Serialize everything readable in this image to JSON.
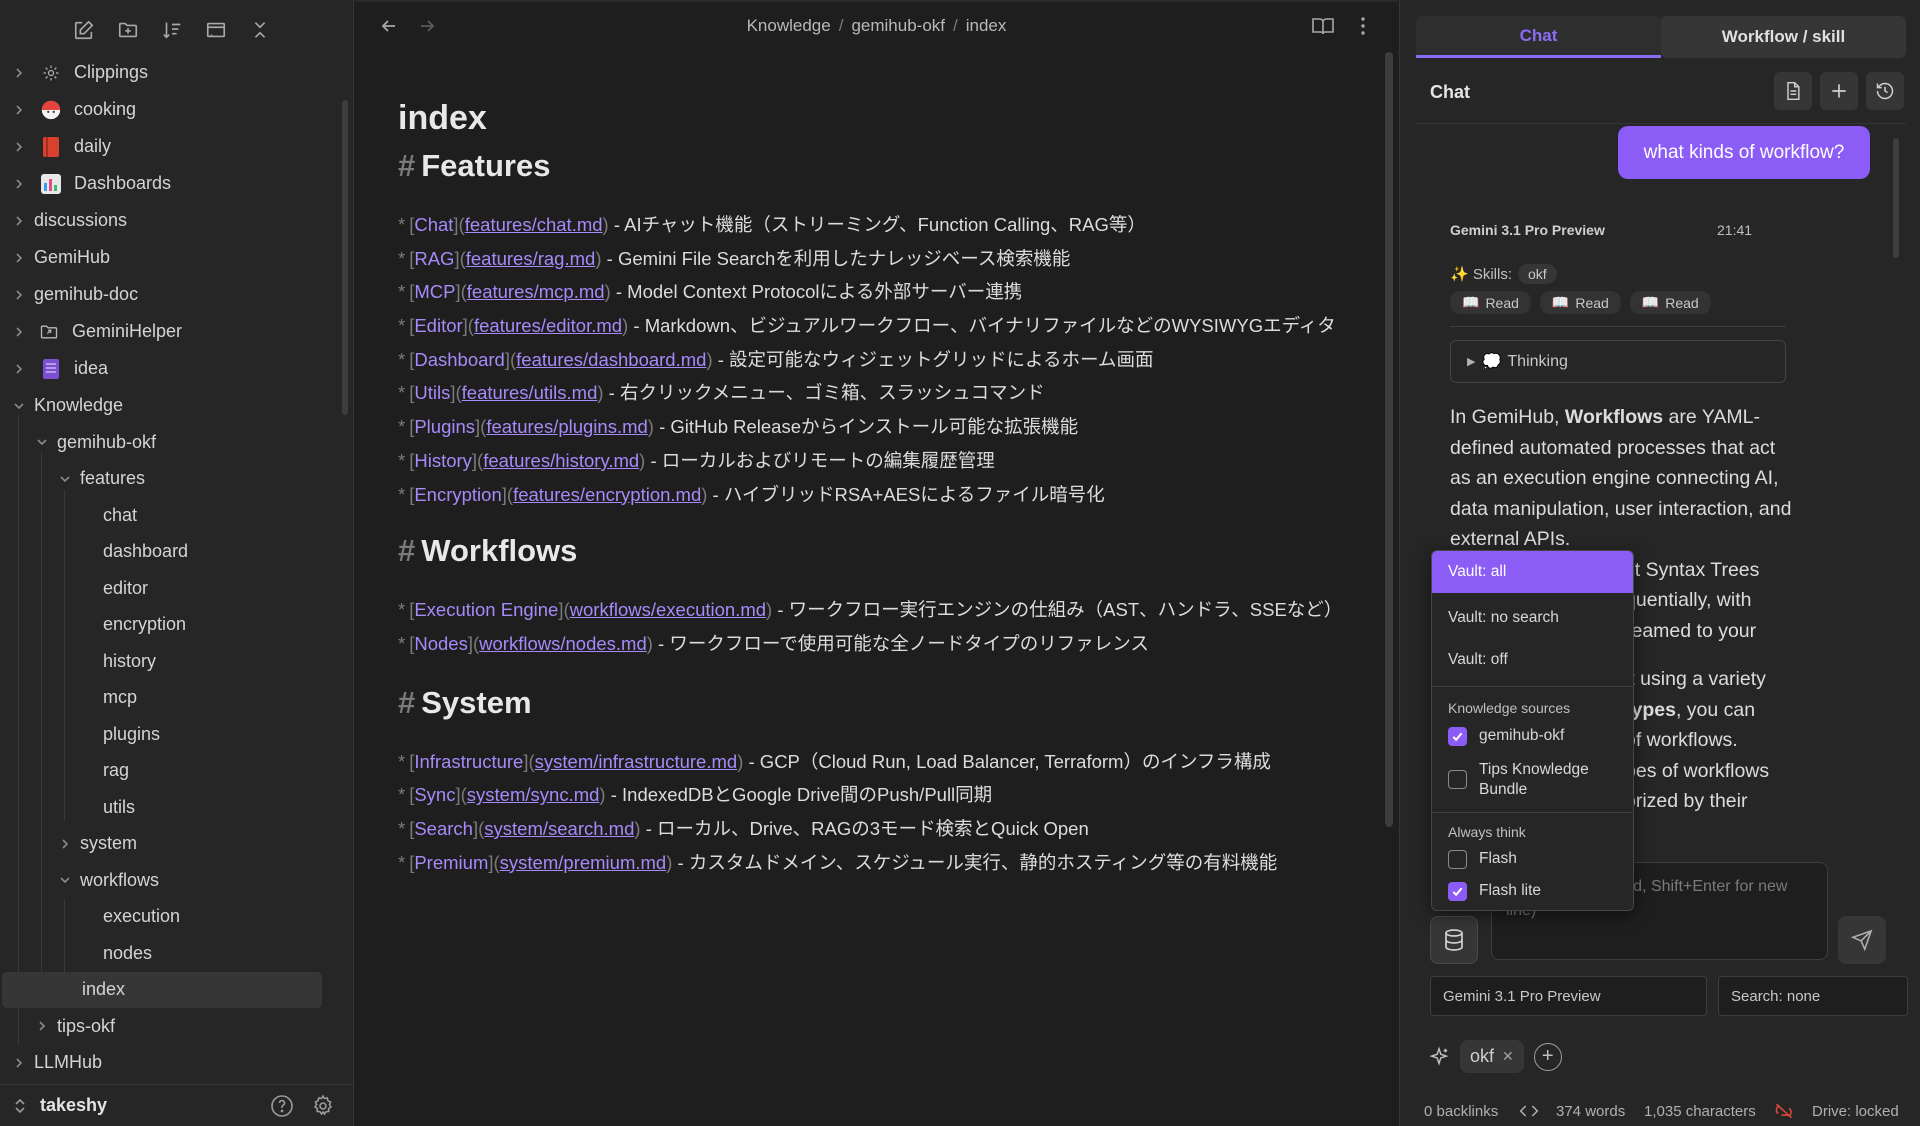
{
  "sidebar": {
    "toolbar": [
      "new-note-icon",
      "new-folder-icon",
      "sort-icon",
      "collapse-panel-icon",
      "collapse-all-icon"
    ],
    "items": [
      {
        "label": "Clippings",
        "icon": "clippings-icon"
      },
      {
        "label": "cooking",
        "icon": "cooking-icon"
      },
      {
        "label": "daily",
        "icon": "daily-icon"
      },
      {
        "label": "Dashboards",
        "icon": "dashboards-icon"
      },
      {
        "label": "discussions"
      },
      {
        "label": "GemiHub"
      },
      {
        "label": "gemihub-doc"
      },
      {
        "label": "GeminiHelper",
        "icon": "folder-link-icon"
      },
      {
        "label": "idea",
        "icon": "idea-icon"
      },
      {
        "label": "Knowledge"
      },
      {
        "label": "gemihub-okf"
      },
      {
        "label": "features"
      },
      {
        "label": "chat"
      },
      {
        "label": "dashboard"
      },
      {
        "label": "editor"
      },
      {
        "label": "encryption"
      },
      {
        "label": "history"
      },
      {
        "label": "mcp"
      },
      {
        "label": "plugins"
      },
      {
        "label": "rag"
      },
      {
        "label": "utils"
      },
      {
        "label": "system"
      },
      {
        "label": "workflows"
      },
      {
        "label": "execution"
      },
      {
        "label": "nodes"
      },
      {
        "label": "index"
      },
      {
        "label": "tips-okf"
      },
      {
        "label": "LLMHub"
      }
    ],
    "vault_name": "takeshy"
  },
  "editor": {
    "breadcrumb": [
      "Knowledge",
      "gemihub-okf",
      "index"
    ],
    "title": "index",
    "sections": [
      {
        "heading": "Features",
        "items": [
          {
            "text": "Chat",
            "url": "features/chat.md",
            "desc": " - AIチャット機能（ストリーミング、Function Calling、RAG等）"
          },
          {
            "text": "RAG",
            "url": "features/rag.md",
            "desc": " - Gemini File Searchを利用したナレッジベース検索機能"
          },
          {
            "text": "MCP",
            "url": "features/mcp.md",
            "desc": " - Model Context Protocolによる外部サーバー連携"
          },
          {
            "text": "Editor",
            "url": "features/editor.md",
            "desc": " - Markdown、ビジュアルワークフロー、バイナリファイルなどのWYSIWYGエディタ"
          },
          {
            "text": "Dashboard",
            "url": "features/dashboard.md",
            "desc": " - 設定可能なウィジェットグリッドによるホーム画面"
          },
          {
            "text": "Utils",
            "url": "features/utils.md",
            "desc": " - 右クリックメニュー、ゴミ箱、スラッシュコマンド"
          },
          {
            "text": "Plugins",
            "url": "features/plugins.md",
            "desc": " - GitHub Releaseからインストール可能な拡張機能"
          },
          {
            "text": "History",
            "url": "features/history.md",
            "desc": " - ローカルおよびリモートの編集履歴管理"
          },
          {
            "text": "Encryption",
            "url": "features/encryption.md",
            "desc": " - ハイブリッドRSA+AESによるファイル暗号化"
          }
        ]
      },
      {
        "heading": "Workflows",
        "items": [
          {
            "text": "Execution Engine",
            "url": "workflows/execution.md",
            "desc": " - ワークフロー実行エンジンの仕組み（AST、ハンドラ、SSEなど）"
          },
          {
            "text": "Nodes",
            "url": "workflows/nodes.md",
            "desc": " - ワークフローで使用可能な全ノードタイプのリファレンス"
          }
        ]
      },
      {
        "heading": "System",
        "items": [
          {
            "text": "Infrastructure",
            "url": "system/infrastructure.md",
            "desc": " - GCP（Cloud Run, Load Balancer, Terraform）のインフラ構成"
          },
          {
            "text": "Sync",
            "url": "system/sync.md",
            "desc": " - IndexedDBとGoogle Drive間のPush/Pull同期"
          },
          {
            "text": "Search",
            "url": "system/search.md",
            "desc": " - ローカル、Drive、RAGの3モード検索とQuick Open"
          },
          {
            "text": "Premium",
            "url": "system/premium.md",
            "desc": " - カスタムドメイン、スケジュール実行、静的ホスティング等の有料機能"
          }
        ]
      }
    ]
  },
  "right_panel": {
    "tabs": [
      "Chat",
      "Workflow / skill"
    ],
    "chat_title": "Chat",
    "user_message": "what kinds of workflow?",
    "model_name": "Gemini 3.1 Pro Preview",
    "message_time": "21:41",
    "skills_label": "✨ Skills:",
    "skill_tag": "okf",
    "read_chips": [
      "Read",
      "Read",
      "Read"
    ],
    "thinking_label": "Thinking",
    "answer": {
      "p1_pre": "In GemiHub, ",
      "p1_bold": "Workflows",
      "p1_post": " are YAML-defined automated processes that act as an execution engine connecting AI, data manipulation, user interaction, and external APIs.",
      "p1_tail": "ct Syntax Trees",
      "p1_tail2": "quentially, with",
      "p1_tail3": "reamed to your",
      "p2_a": "lt using a variety",
      "p2_bold": "types",
      "p2_b": ", you can",
      "p2_c": "of workflows.",
      "p2_d": "pes of workflows",
      "p2_e": "orized by their"
    },
    "input_placeholder": "ge... (Enter to send, Shift+Enter for new line)",
    "model_select": "Gemini 3.1 Pro Preview",
    "search_select": "Search: none",
    "active_skill": "okf",
    "status": {
      "backlinks": "0 backlinks",
      "words": "374 words",
      "chars": "1,035 characters",
      "drive": "Drive: locked"
    }
  },
  "vault_menu": {
    "options": [
      "Vault: all",
      "Vault: no search",
      "Vault: off"
    ],
    "selected": "Vault: all",
    "knowledge_heading": "Knowledge sources",
    "knowledge": [
      {
        "label": "gemihub-okf",
        "checked": true
      },
      {
        "label": "Tips Knowledge Bundle",
        "checked": false
      }
    ],
    "think_heading": "Always think",
    "think": [
      {
        "label": "Flash",
        "checked": false
      },
      {
        "label": "Flash lite",
        "checked": true
      }
    ]
  },
  "colors": {
    "accent": "#8b5cf6",
    "link": "#a68af9",
    "background": "#1e1e1e",
    "panel": "#262626"
  }
}
